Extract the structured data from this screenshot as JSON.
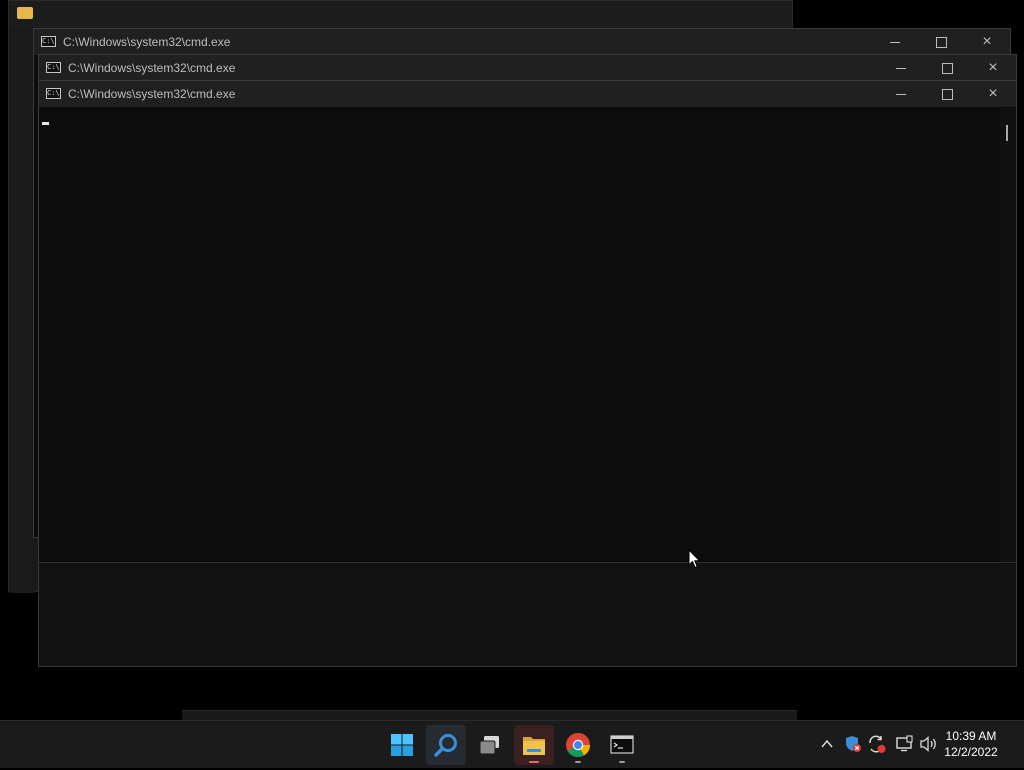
{
  "background_window": {
    "app": "File Explorer",
    "icon": "folder-icon"
  },
  "windows": [
    {
      "title": "C:\\Windows\\system32\\cmd.exe",
      "icon": "cmd-icon",
      "icon_text": "C:\\_",
      "buttons": {
        "minimize": "minimize-icon",
        "maximize": "maximize-icon",
        "close": "×"
      }
    },
    {
      "title": "C:\\Windows\\system32\\cmd.exe",
      "icon": "cmd-icon",
      "icon_text": "C:\\_",
      "buttons": {
        "minimize": "minimize-icon",
        "maximize": "maximize-icon",
        "close": "×"
      }
    },
    {
      "title": "C:\\Windows\\system32\\cmd.exe",
      "icon": "cmd-icon",
      "icon_text": "C:\\_",
      "buttons": {
        "minimize": "minimize-icon",
        "maximize": "maximize-icon",
        "close": "×"
      }
    }
  ],
  "taskbar": {
    "apps": [
      {
        "name": "Start",
        "icon": "windows-start-icon",
        "color": "#4cc2ff"
      },
      {
        "name": "Search",
        "icon": "search-icon",
        "color": "#3a8fd6",
        "active": true
      },
      {
        "name": "Task View",
        "icon": "task-view-icon",
        "color": "#d8d8d8"
      },
      {
        "name": "File Explorer",
        "icon": "folder-icon",
        "color": "#f1c24b",
        "active": true,
        "running": true
      },
      {
        "name": "Google Chrome",
        "icon": "chrome-icon",
        "running": true
      },
      {
        "name": "Command Prompt",
        "icon": "terminal-icon",
        "running": true
      }
    ],
    "tray": {
      "overflow_icon": "chevron-up-icon",
      "security_icon": "shield-alert-icon",
      "sync_icon": "sync-alert-icon",
      "network_icon": "network-icon",
      "volume_icon": "volume-icon"
    },
    "clock": {
      "time": "10:39 AM",
      "date": "12/2/2022"
    }
  },
  "colors": {
    "console_bg": "#0c0c0c",
    "titlebar_bg": "#202020",
    "taskbar_bg": "#1b1b1b",
    "accent": "#4cc2ff"
  }
}
